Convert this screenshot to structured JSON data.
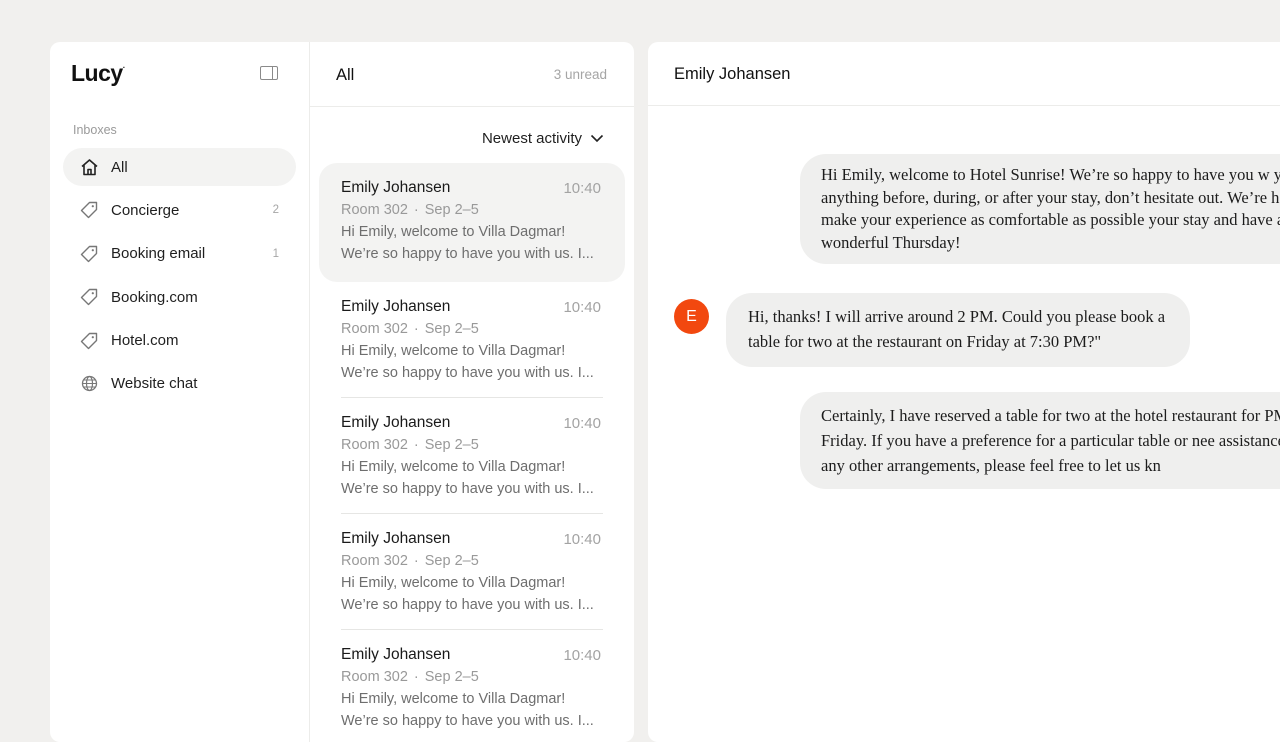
{
  "sidebar": {
    "logo": "Lucy",
    "inboxes_heading": "Inboxes",
    "items": [
      {
        "label": "All",
        "count": "",
        "icon": "home-icon"
      },
      {
        "label": "Concierge",
        "count": "2",
        "icon": "tag-icon"
      },
      {
        "label": "Booking email",
        "count": "1",
        "icon": "tag-icon"
      },
      {
        "label": "Booking.com",
        "count": "",
        "icon": "tag-icon"
      },
      {
        "label": "Hotel.com",
        "count": "",
        "icon": "tag-icon"
      },
      {
        "label": "Website chat",
        "count": "",
        "icon": "globe-icon"
      }
    ]
  },
  "list": {
    "title": "All",
    "unread": "3 unread",
    "sort_label": "Newest activity",
    "conversations": [
      {
        "name": "Emily Johansen",
        "time": "10:40",
        "room": "Room 302",
        "dates": "Sep 2–5",
        "line1": "Hi Emily, welcome to Villa Dagmar!",
        "line2": "We’re so happy to have you with us. I..."
      },
      {
        "name": "Emily Johansen",
        "time": "10:40",
        "room": "Room 302",
        "dates": "Sep 2–5",
        "line1": "Hi Emily, welcome to Villa Dagmar!",
        "line2": "We’re so happy to have you with us. I..."
      },
      {
        "name": "Emily Johansen",
        "time": "10:40",
        "room": "Room 302",
        "dates": "Sep 2–5",
        "line1": "Hi Emily, welcome to Villa Dagmar!",
        "line2": "We’re so happy to have you with us. I..."
      },
      {
        "name": "Emily Johansen",
        "time": "10:40",
        "room": "Room 302",
        "dates": "Sep 2–5",
        "line1": "Hi Emily, welcome to Villa Dagmar!",
        "line2": "We’re so happy to have you with us. I..."
      },
      {
        "name": "Emily Johansen",
        "time": "10:40",
        "room": "Room 302",
        "dates": "Sep 2–5",
        "line1": "Hi Emily, welcome to Villa Dagmar!",
        "line2": "We’re so happy to have you with us. I..."
      }
    ]
  },
  "chat": {
    "title": "Emily Johansen",
    "avatar_initial": "E",
    "avatar_color": "#f2480f",
    "messages": [
      {
        "direction": "out",
        "text": "Hi Emily, welcome to Hotel Sunrise! We’re so happy to have you w you need anything before, during, or after your stay, don’t hesitate out. We’re here to make your experience as comfortable as possible your stay and have a wonderful Thursday!"
      },
      {
        "direction": "in",
        "text": "Hi, thanks! I will arrive around 2 PM. Could you please book a table for two at the restaurant on Friday at 7:30 PM?\""
      },
      {
        "direction": "out",
        "text": "Certainly, I have reserved a table for two at the hotel restaurant for PM on Friday. If you have a preference for a particular table or nee assistance with any other arrangements, please feel free to let us kn"
      }
    ]
  }
}
